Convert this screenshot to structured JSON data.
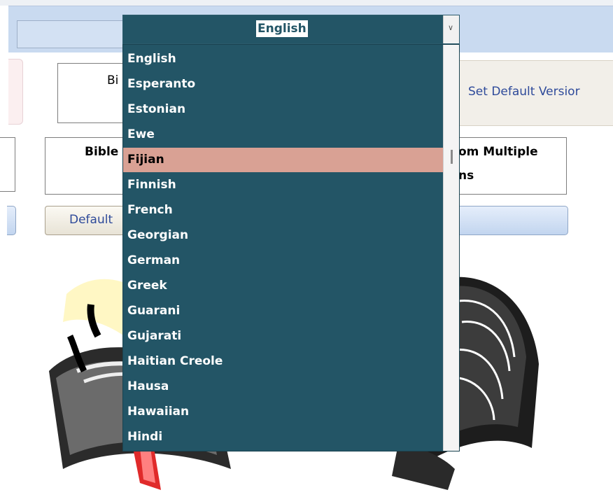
{
  "combo": {
    "value": "English",
    "arrow": "chevron-down-icon"
  },
  "languages": [
    "English",
    "Esperanto",
    "Estonian",
    "Ewe",
    "Fijian",
    "Finnish",
    "French",
    "Georgian",
    "German",
    "Greek",
    "Guarani",
    "Gujarati",
    "Haitian Creole",
    "Hausa",
    "Hawaiian",
    "Hindi"
  ],
  "selected_language": "Fijian",
  "background": {
    "frame1_text": "Bi",
    "frame2_text": "Bible",
    "right_frame_line1": "om Multiple",
    "right_frame_line2": "ns",
    "set_default_version": "Set Default Versior",
    "default_button": "Default"
  },
  "colors": {
    "dropdown_bg": "#235566",
    "selected_bg": "#d9a194",
    "header_bar": "#c9daf0",
    "link_text": "#2e4a9a"
  }
}
